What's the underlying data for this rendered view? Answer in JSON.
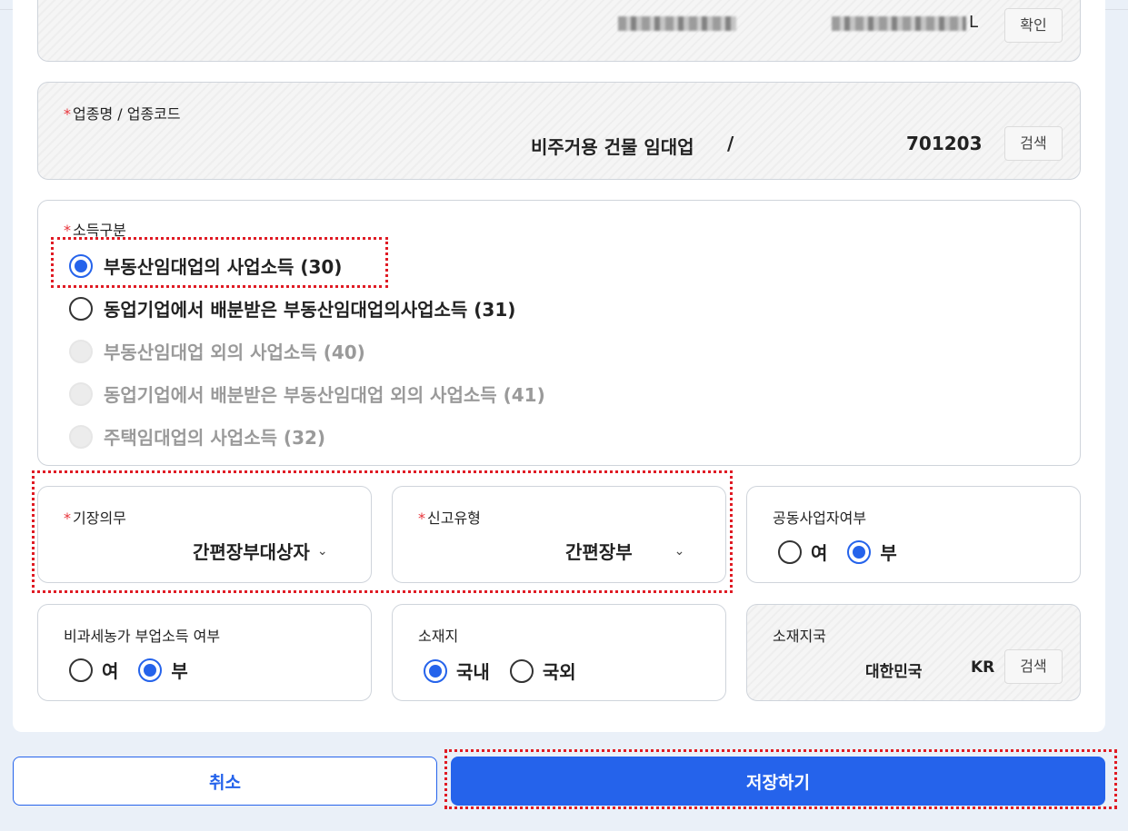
{
  "business_number": {
    "confirm_label": "확인",
    "tail_char": "L"
  },
  "industry": {
    "label": "업종명 / 업종코드",
    "name": "비주거용 건물 임대업",
    "separator": "/",
    "code": "701203",
    "search_label": "검색"
  },
  "income_type": {
    "label": "소득구분",
    "options": [
      {
        "label": "부동산임대업의 사업소득 (30)",
        "state": "checked"
      },
      {
        "label": "동업기업에서 배분받은 부동산임대업의사업소득 (31)",
        "state": "unchecked"
      },
      {
        "label": "부동산임대업 외의 사업소득 (40)",
        "state": "disabled"
      },
      {
        "label": "동업기업에서 배분받은 부동산임대업 외의 사업소득 (41)",
        "state": "disabled"
      },
      {
        "label": "주택임대업의 사업소득 (32)",
        "state": "disabled"
      }
    ]
  },
  "bookkeeping": {
    "label": "기장의무",
    "value": "간편장부대상자",
    "chevron": "⌄"
  },
  "report_type": {
    "label": "신고유형",
    "value": "간편장부",
    "chevron": "⌄"
  },
  "joint_business": {
    "label": "공동사업자여부",
    "yes": "여",
    "no": "부",
    "selected": "no"
  },
  "farm_income": {
    "label": "비과세농가 부업소득 여부",
    "yes": "여",
    "no": "부",
    "selected": "no"
  },
  "location": {
    "label": "소재지",
    "domestic": "국내",
    "foreign": "국외",
    "selected": "domestic"
  },
  "country": {
    "label": "소재지국",
    "name": "대한민국",
    "code": "KR",
    "search_label": "검색"
  },
  "footer": {
    "cancel_label": "취소",
    "save_label": "저장하기"
  },
  "colors": {
    "primary": "#2563eb",
    "required": "#e8333a",
    "highlight": "#e01b24"
  }
}
